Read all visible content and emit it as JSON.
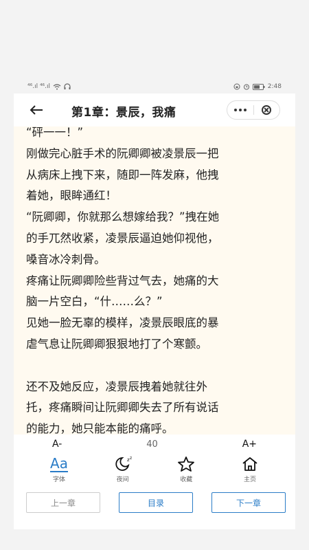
{
  "status": {
    "left_indicators": "⁴⁶.ıl ⁴⁶.ıl",
    "time": "2:48"
  },
  "header": {
    "title": "第1章：景辰，我痛"
  },
  "content": {
    "lines": [
      "“砰一一！”",
      "刚做完心脏手术的阮卿卿被凌景辰一把",
      "从病床上拽下来，随即一阵发麻，他拽",
      "着她，眼眸通红！",
      "“阮卿卿，你就那么想嫁给我？”拽在她",
      "的手兀然收紧，凌景辰逼迫她仰视他，",
      "嗓音冰冷刺骨。",
      "疼痛让阮卿卿险些背过气去，她痛的大",
      "脑一片空白，“什……么？”",
      "见她一脸无辜的模样，凌景辰眼底的暴",
      "虐气息让阮卿卿狠狠地打了个寒颤。",
      "",
      "还不及她反应，凌景辰拽着她就往外",
      "托，疼痛瞬间让阮卿卿失去了所有说话",
      "的能力，她只能本能的痛呼。"
    ]
  },
  "controls": {
    "font_decrease": "A-",
    "font_size": "40",
    "font_increase": "A+",
    "icons": [
      {
        "label": "字体",
        "icon": "font-aa-icon",
        "glyph": "Aa"
      },
      {
        "label": "夜间",
        "icon": "night-moon-icon"
      },
      {
        "label": "收藏",
        "icon": "star-icon"
      },
      {
        "label": "主页",
        "icon": "home-icon"
      }
    ],
    "prev_chapter": "上一章",
    "catalog": "目录",
    "next_chapter": "下一章"
  },
  "colors": {
    "accent": "#2a7cc7",
    "page_background": "#fffaf0"
  }
}
